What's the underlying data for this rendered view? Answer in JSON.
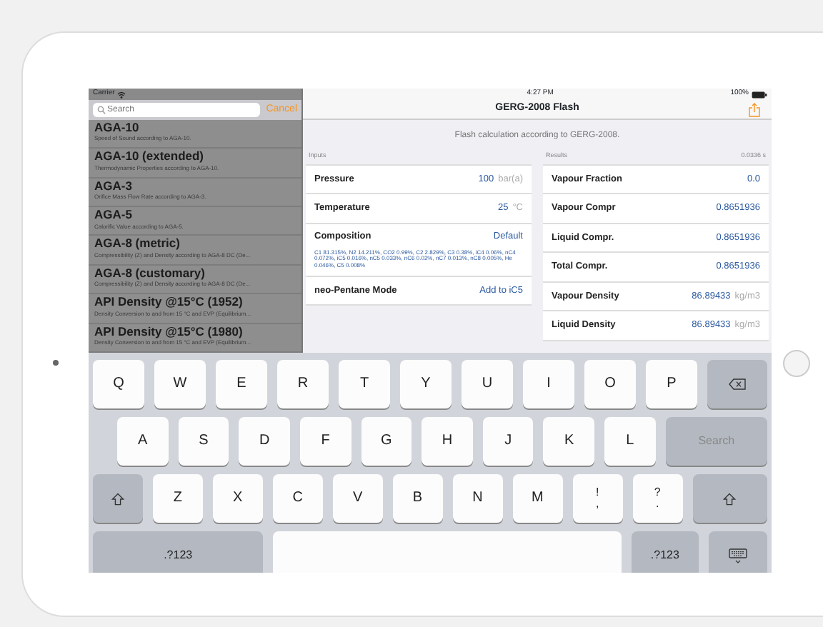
{
  "status_bar": {
    "carrier": "Carrier",
    "time": "4:27 PM",
    "battery": "100%"
  },
  "sidebar": {
    "search": {
      "placeholder": "Search"
    },
    "cancel": "Cancel",
    "items": [
      {
        "title": "AGA-10",
        "subtitle": "Speed of Sound according to AGA-10."
      },
      {
        "title": "AGA-10 (extended)",
        "subtitle": "Thermodynamic Properties according to AGA-10."
      },
      {
        "title": "AGA-3",
        "subtitle": "Orifice Mass Flow Rate according to AGA-3."
      },
      {
        "title": "AGA-5",
        "subtitle": "Calorific Value according to AGA-5."
      },
      {
        "title": "AGA-8 (metric)",
        "subtitle": "Compressibility (Z) and Density according to AGA-8 DC (De..."
      },
      {
        "title": "AGA-8 (customary)",
        "subtitle": "Compressibility (Z) and Density according to AGA-8 DC (De..."
      },
      {
        "title": "API Density @15°C (1952)",
        "subtitle": "Density Conversion to and from 15 °C and EVP (Equilibrium..."
      },
      {
        "title": "API Density @15°C (1980)",
        "subtitle": "Density Conversion to and from 15 °C and EVP (Equilibrium..."
      }
    ]
  },
  "detail": {
    "title": "GERG-2008 Flash",
    "description": "Flash calculation according to GERG-2008.",
    "inputs": {
      "header": "Inputs",
      "rows": [
        {
          "label": "Pressure",
          "value": "100",
          "unit": "bar(a)"
        },
        {
          "label": "Temperature",
          "value": "25",
          "unit": "°C"
        },
        {
          "label": "Composition",
          "value": "Default",
          "note": "C1 81.315%, N2 14.211%, CO2 0.99%, C2 2.829%, C3 0.38%, iC4 0.06%, nC4 0.072%, iC5 0.016%, nC5 0.033%, nC6 0.02%, nC7 0.013%, nC8 0.005%, He 0.046%, C5 0.008%"
        },
        {
          "label": "neo-Pentane Mode",
          "value": "Add to iC5"
        }
      ]
    },
    "results": {
      "header": "Results",
      "elapsed": "0.0336 s",
      "rows": [
        {
          "label": "Vapour Fraction",
          "value": "0.0"
        },
        {
          "label": "Vapour Compr",
          "value": "0.8651936"
        },
        {
          "label": "Liquid Compr.",
          "value": "0.8651936"
        },
        {
          "label": "Total Compr.",
          "value": "0.8651936"
        },
        {
          "label": "Vapour Density",
          "value": "86.89433",
          "unit": "kg/m3"
        },
        {
          "label": "Liquid Density",
          "value": "86.89433",
          "unit": "kg/m3"
        }
      ]
    }
  },
  "keyboard": {
    "key_rows": [
      [
        {
          "kind": "key",
          "label": "Q"
        },
        {
          "kind": "key",
          "label": "W"
        },
        {
          "kind": "key",
          "label": "E"
        },
        {
          "kind": "key",
          "label": "R"
        },
        {
          "kind": "key",
          "label": "T"
        },
        {
          "kind": "key",
          "label": "Y"
        },
        {
          "kind": "key",
          "label": "U"
        },
        {
          "kind": "key",
          "label": "I"
        },
        {
          "kind": "key",
          "label": "O"
        },
        {
          "kind": "key",
          "label": "P"
        },
        {
          "kind": "backspace"
        }
      ],
      [
        {
          "kind": "key",
          "label": "A"
        },
        {
          "kind": "key",
          "label": "S"
        },
        {
          "kind": "key",
          "label": "D"
        },
        {
          "kind": "key",
          "label": "F"
        },
        {
          "kind": "key",
          "label": "G"
        },
        {
          "kind": "key",
          "label": "H"
        },
        {
          "kind": "key",
          "label": "J"
        },
        {
          "kind": "key",
          "label": "K"
        },
        {
          "kind": "key",
          "label": "L"
        },
        {
          "kind": "search",
          "label": "Search"
        }
      ],
      [
        {
          "kind": "shift"
        },
        {
          "kind": "key",
          "label": "Z"
        },
        {
          "kind": "key",
          "label": "X"
        },
        {
          "kind": "key",
          "label": "C"
        },
        {
          "kind": "key",
          "label": "V"
        },
        {
          "kind": "key",
          "label": "B"
        },
        {
          "kind": "key",
          "label": "N"
        },
        {
          "kind": "key",
          "label": "M"
        },
        {
          "kind": "dual",
          "label": "!",
          "lower": ","
        },
        {
          "kind": "dual",
          "label": "?",
          "lower": "."
        },
        {
          "kind": "shift"
        }
      ],
      [
        {
          "kind": "mode",
          "label": ".?123"
        },
        {
          "kind": "space"
        },
        {
          "kind": "mode",
          "label": ".?123"
        },
        {
          "kind": "hide"
        }
      ]
    ]
  }
}
